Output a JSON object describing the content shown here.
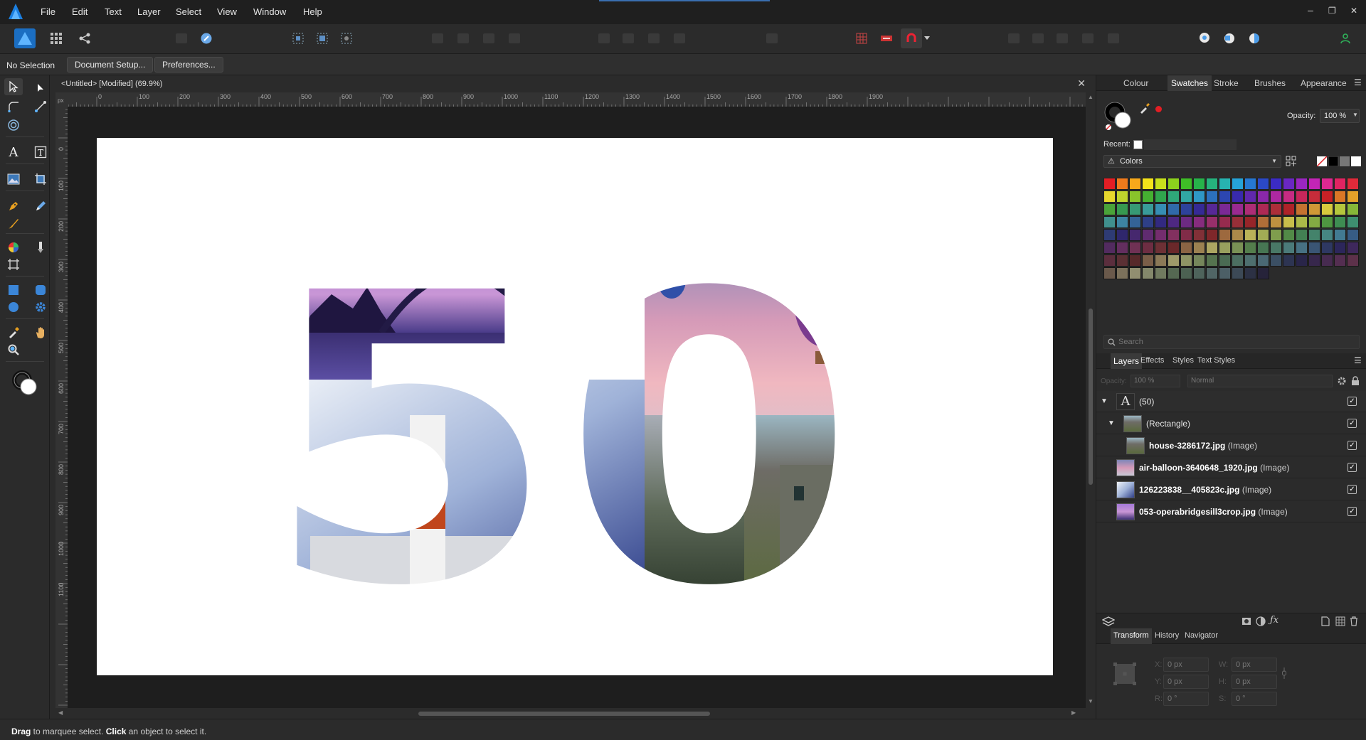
{
  "menu": {
    "items": [
      "File",
      "Edit",
      "Text",
      "Layer",
      "Select",
      "View",
      "Window",
      "Help"
    ],
    "window_controls": [
      "–",
      "❐",
      "✕"
    ]
  },
  "context": {
    "selection": "No Selection",
    "document_setup": "Document Setup...",
    "preferences": "Preferences..."
  },
  "document": {
    "tab_title": "<Untitled> [Modified] (69.9%)",
    "close": "✕"
  },
  "rulers": {
    "h": [
      "0",
      "100",
      "200",
      "300",
      "400",
      "500",
      "600",
      "700",
      "800",
      "900",
      "1000",
      "1100",
      "1200",
      "1300",
      "1400",
      "1500",
      "1600",
      "1700",
      "1800",
      "1900"
    ],
    "v": [
      "0",
      "100",
      "200",
      "300",
      "400",
      "500",
      "600",
      "700",
      "800",
      "900",
      "1000",
      "1100"
    ],
    "unit": "px"
  },
  "artwork": {
    "text": "50"
  },
  "status": {
    "bold1": "Drag",
    "t1": " to marquee select. ",
    "bold2": "Click",
    "t2": " an object to select it."
  },
  "colour_panel": {
    "tabs": [
      "Colour",
      "Swatches",
      "Stroke",
      "Brushes",
      "Appearance"
    ],
    "active_tab": "Swatches",
    "opacity_label": "Opacity:",
    "opacity_value": "100 %",
    "recent_label": "Recent:",
    "palette_name": "Colors",
    "search_placeholder": "Search",
    "colors": {
      "fill": "#ffffff",
      "stroke": "#000000",
      "accent": "#e31e24"
    }
  },
  "layers_panel": {
    "tabs": [
      "Layers",
      "Effects",
      "Styles",
      "Text Styles"
    ],
    "active_tab": "Layers",
    "opacity_label": "Opacity:",
    "opacity_value": "100 %",
    "blend_mode": "Normal",
    "layers": [
      {
        "name": "(50)",
        "type": ""
      },
      {
        "name": "(Rectangle)",
        "type": ""
      },
      {
        "name": "house-3286172.jpg",
        "type": "(Image)"
      },
      {
        "name": "air-balloon-3640648_1920.jpg",
        "type": "(Image)"
      },
      {
        "name": "126223838__405823c.jpg",
        "type": "(Image)"
      },
      {
        "name": "053-operabridgesill3crop.jpg",
        "type": "(Image)"
      }
    ]
  },
  "transform_panel": {
    "tabs": [
      "Transform",
      "History",
      "Navigator"
    ],
    "active_tab": "Transform",
    "x_label": "X:",
    "x": "0 px",
    "y_label": "Y:",
    "y": "0 px",
    "w_label": "W:",
    "w": "0 px",
    "h_label": "H:",
    "h": "0 px",
    "r_label": "R:",
    "r": "0 °",
    "s_label": "S:",
    "s": "0 °"
  }
}
